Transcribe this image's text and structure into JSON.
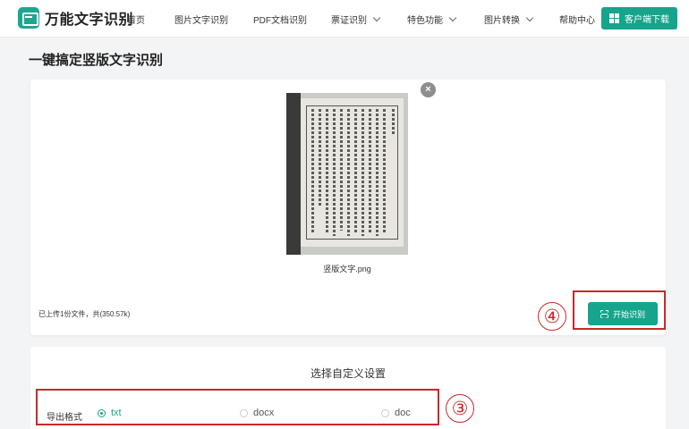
{
  "header": {
    "logo_text": "万能文字识别",
    "nav": [
      {
        "label": "首页",
        "dropdown": false
      },
      {
        "label": "图片文字识别",
        "dropdown": false
      },
      {
        "label": "PDF文档识别",
        "dropdown": false
      },
      {
        "label": "票证识别",
        "dropdown": true
      },
      {
        "label": "特色功能",
        "dropdown": true
      },
      {
        "label": "图片转换",
        "dropdown": true
      },
      {
        "label": "帮助中心",
        "dropdown": false
      }
    ],
    "download_label": "客户端下载"
  },
  "page": {
    "title": "一键搞定竖版文字识别"
  },
  "upload": {
    "file_name": "竖版文字.png",
    "info": "已上传1份文件，共(350.57k)",
    "start_label": "开始识别",
    "close_symbol": "×"
  },
  "annotations": {
    "step3": "③",
    "step4": "④",
    "color": "#c8292b"
  },
  "settings": {
    "title": "选择自定义设置",
    "format_label": "导出格式",
    "options": [
      {
        "label": "txt",
        "selected": true
      },
      {
        "label": "docx",
        "selected": false
      },
      {
        "label": "doc",
        "selected": false
      }
    ]
  },
  "colors": {
    "accent": "#16a48c"
  }
}
